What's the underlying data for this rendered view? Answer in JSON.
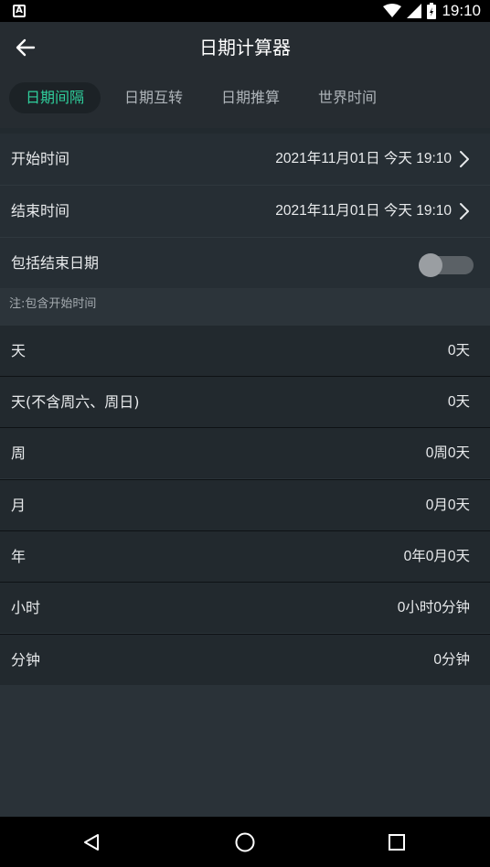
{
  "status": {
    "time": "19:10",
    "notification_icon": "a-notification-icon"
  },
  "toolbar": {
    "title": "日期计算器",
    "back_icon": "back-arrow-icon"
  },
  "tabs": [
    {
      "label": "日期间隔",
      "active": true
    },
    {
      "label": "日期互转",
      "active": false
    },
    {
      "label": "日期推算",
      "active": false
    },
    {
      "label": "世界时间",
      "active": false
    }
  ],
  "settings": {
    "start": {
      "label": "开始时间",
      "value": "2021年11月01日 今天 19:10"
    },
    "end": {
      "label": "结束时间",
      "value": "2021年11月01日 今天 19:10"
    },
    "include_end": {
      "label": "包括结束日期",
      "on": false
    }
  },
  "note": "注:包含开始时间",
  "results": [
    {
      "label": "天",
      "value": "0天"
    },
    {
      "label": "天(不含周六、周日)",
      "value": "0天"
    },
    {
      "label": "周",
      "value": "0周0天"
    },
    {
      "label": "月",
      "value": "0月0天"
    },
    {
      "label": "年",
      "value": "0年0月0天"
    },
    {
      "label": "小时",
      "value": "0小时0分钟"
    },
    {
      "label": "分钟",
      "value": "0分钟"
    }
  ],
  "colors": {
    "accent": "#2fcf9c",
    "background": "#2a3238",
    "bar": "#262c31"
  }
}
